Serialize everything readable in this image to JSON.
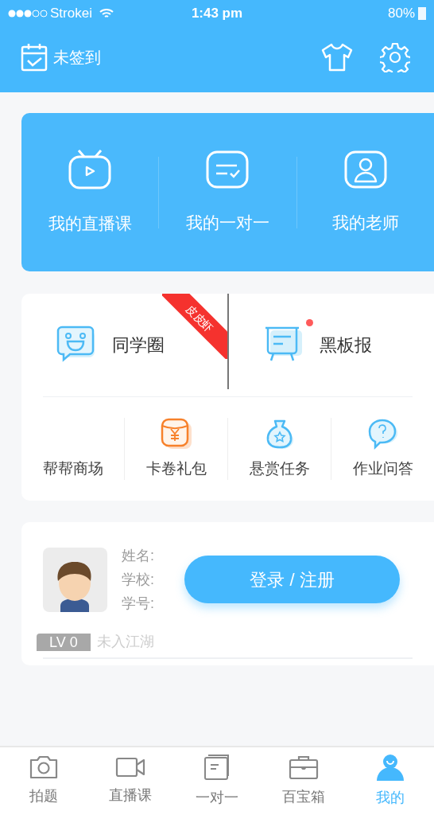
{
  "status_bar": {
    "carrier": "Strokei",
    "time": "1:43 pm",
    "battery": "80%"
  },
  "header": {
    "checkin_label": "未签到"
  },
  "courses": [
    {
      "label": "我的直播课"
    },
    {
      "label": "我的一对一"
    },
    {
      "label": "我的老师"
    }
  ],
  "features": [
    {
      "label": "同学圈",
      "ribbon": "皮皮虾",
      "unread": false
    },
    {
      "label": "黑板报",
      "unread": true
    }
  ],
  "tools": [
    {
      "label": "帮帮商场"
    },
    {
      "label": "卡卷礼包"
    },
    {
      "label": "悬赏任务"
    },
    {
      "label": "作业问答"
    }
  ],
  "profile": {
    "fields": [
      "姓名:",
      "学校:",
      "学号:"
    ],
    "login_button": "登录 / 注册",
    "level": "LV 0",
    "rank": "未入江湖"
  },
  "tabs": [
    {
      "label": "拍题",
      "selected": false
    },
    {
      "label": "直播课",
      "selected": false
    },
    {
      "label": "一对一",
      "selected": false
    },
    {
      "label": "百宝箱",
      "selected": false
    },
    {
      "label": "我的",
      "selected": true
    }
  ]
}
